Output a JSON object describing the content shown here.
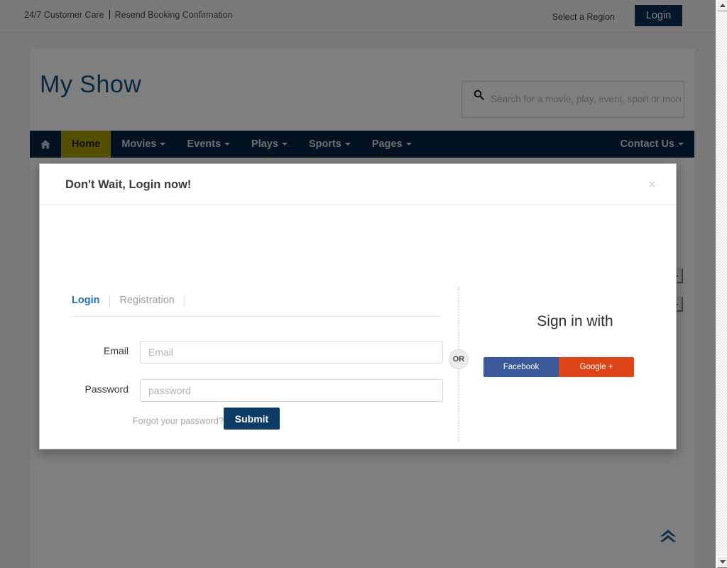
{
  "topbar": {
    "customer_care": "24/7 Customer Care",
    "resend_confirmation": "Resend Booking Confirmation",
    "region_label": "Select a Region",
    "login_label": "Login"
  },
  "header": {
    "brand": "My Show",
    "search_placeholder": "Search for a movie, play, event, sport or more",
    "search_value": "",
    "search_icon": "search-icon"
  },
  "nav": {
    "home_icon": "home-icon",
    "items": [
      {
        "label": "Home",
        "caret": false,
        "active": true
      },
      {
        "label": "Movies",
        "caret": true,
        "active": false
      },
      {
        "label": "Events",
        "caret": true,
        "active": false
      },
      {
        "label": "Plays",
        "caret": true,
        "active": false
      },
      {
        "label": "Sports",
        "caret": true,
        "active": false
      },
      {
        "label": "Pages",
        "caret": true,
        "active": false
      }
    ],
    "contact": {
      "label": "Contact Us",
      "caret": true
    }
  },
  "modal": {
    "title": "Don't Wait, Login now!",
    "close_label": "×",
    "close_icon": "close-icon",
    "tabs": [
      {
        "label": "Login",
        "active": true
      },
      {
        "label": "Registration",
        "active": false
      }
    ],
    "form": {
      "email_label": "Email",
      "email_placeholder": "Email",
      "email_value": "",
      "password_label": "Password",
      "password_placeholder": "password",
      "password_value": "",
      "forgot_label": "Forgot your password?",
      "submit_label": "Submit"
    },
    "divider_badge": "OR",
    "social": {
      "title": "Sign in with",
      "facebook_label": "Facebook",
      "google_label": "Google +",
      "facebook_color": "#3b5a9b",
      "google_color": "#e0451a"
    }
  },
  "page": {
    "scroll_top_icon": "double-chevron-up-icon"
  },
  "colors": {
    "nav_bg": "#042541",
    "nav_active_bg": "#a8a007",
    "brand": "#11527f",
    "primary_button": "#0d3b66",
    "tab_active": "#2070b8",
    "backdrop": "rgba(0,0,0,0.5)"
  }
}
